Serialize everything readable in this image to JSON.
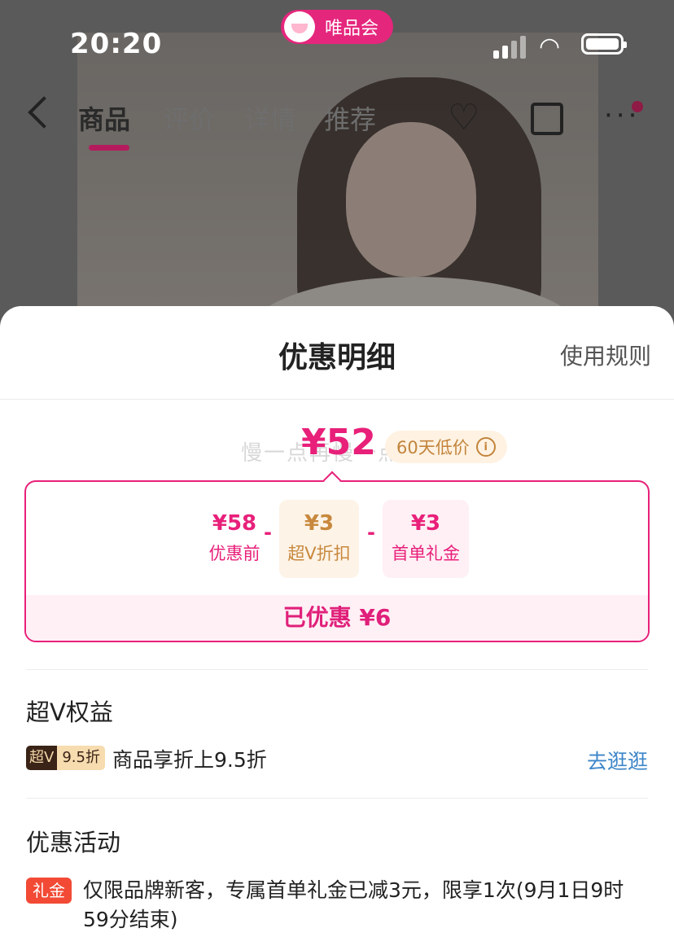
{
  "status_bar": {
    "time": "20:20",
    "app_badge": "唯品会"
  },
  "nav": {
    "tabs": [
      "商品",
      "评价",
      "详情",
      "推荐"
    ],
    "icons": [
      "back-icon",
      "heart-plus-icon",
      "share-icon",
      "more-icon"
    ]
  },
  "sheet": {
    "title": "优惠明细",
    "rules_link": "使用规则",
    "watermark": "慢一点再慢一点",
    "final_price": "¥52",
    "low_price_badge": "60天低价",
    "breakdown": {
      "original": {
        "value": "¥58",
        "label": "优惠前"
      },
      "super_v": {
        "value": "¥3",
        "label": "超V折扣"
      },
      "first_gift": {
        "value": "¥3",
        "label": "首单礼金"
      },
      "operator": "-",
      "saved": "已优惠 ¥6"
    },
    "super_v_section": {
      "title": "超V权益",
      "badge_left": "超V",
      "badge_right": "9.5折",
      "text": "商品享折上9.5折",
      "action": "去逛逛"
    },
    "promo_section": {
      "title": "优惠活动",
      "badge": "礼金",
      "text": "仅限品牌新客，专属首单礼金已减3元，限享1次(9月1日9时59分结束)"
    }
  },
  "colors": {
    "accent": "#e8207a",
    "gold": "#c8883d",
    "link": "#3d86c9",
    "gift_red": "#f24a35"
  }
}
